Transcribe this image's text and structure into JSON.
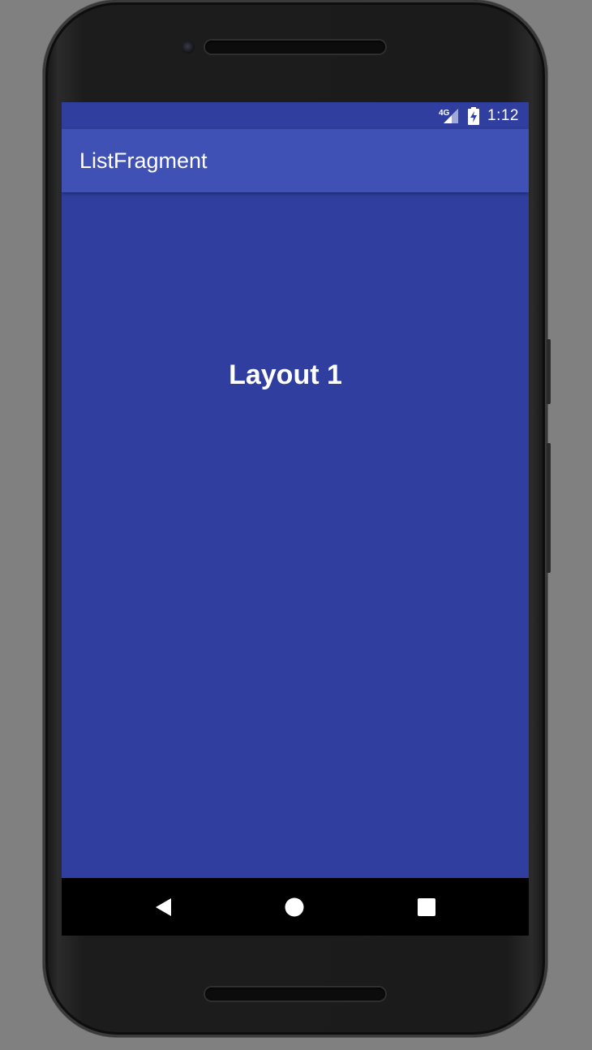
{
  "status_bar": {
    "network_label": "4G",
    "time": "1:12",
    "signal_icon": "signal-icon",
    "battery_icon": "battery-charging-icon"
  },
  "app_bar": {
    "title": "ListFragment"
  },
  "content": {
    "label": "Layout 1"
  },
  "nav_bar": {
    "back_icon": "back-icon",
    "home_icon": "home-icon",
    "recents_icon": "recents-icon"
  },
  "colors": {
    "primary": "#3f51b5",
    "primary_dark": "#303f9f",
    "nav_bar": "#000000"
  }
}
